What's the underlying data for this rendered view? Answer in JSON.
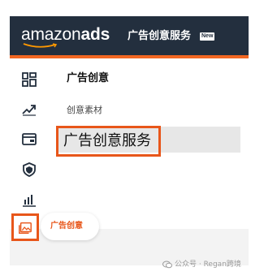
{
  "header": {
    "logo_main": "amazon",
    "logo_ads": "ads",
    "title": "广告创意服务",
    "badge": "New"
  },
  "sidebar": {
    "section_title": "广告创意",
    "items": [
      {
        "label": "创意素材"
      },
      {
        "label": "广告创意服务",
        "selected": true
      }
    ]
  },
  "rail": {
    "icons": [
      "dashboard-icon",
      "trend-icon",
      "wallet-icon",
      "shield-icon",
      "bar-chart-icon",
      "creative-gallery-icon"
    ],
    "active_tooltip": "广告创意"
  },
  "watermark": {
    "text": "公众号 · Regan跨境"
  },
  "colors": {
    "header_bg": "#232f3e",
    "accent": "#e8561a",
    "selected_bg": "#e7e7e7"
  }
}
